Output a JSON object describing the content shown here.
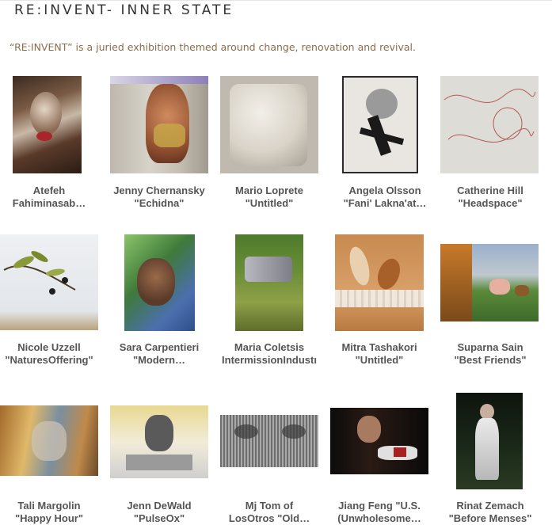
{
  "page": {
    "title": "RE:INVENT- INNER STATE",
    "subtitle": "“RE:INVENT” is a juried exhibition themed around change, renovation and revival."
  },
  "artworks": [
    {
      "line1": "Atefeh",
      "line2": "Fahiminasab…"
    },
    {
      "line1": "Jenny Chernansky",
      "line2": "\"Echidna\""
    },
    {
      "line1": "Mario Loprete",
      "line2": "\"Untitled\""
    },
    {
      "line1": "Angela Olsson",
      "line2": "\"Fani' Lakna'at…"
    },
    {
      "line1": "Catherine Hill",
      "line2": "\"Headspace\""
    },
    {
      "line1": "Nicole Uzzell",
      "line2": "\"NaturesOffering\""
    },
    {
      "line1": "Sara Carpentieri",
      "line2": "\"Modern…"
    },
    {
      "line1": "Maria Coletsis",
      "line2": "IntermissionIndustı"
    },
    {
      "line1": "Mitra Tashakori",
      "line2": "\"Untitled\""
    },
    {
      "line1": "Suparna Sain",
      "line2": "\"Best Friends\""
    },
    {
      "line1": "Tali Margolin",
      "line2": "\"Happy Hour\""
    },
    {
      "line1": "Jenn DeWald",
      "line2": "\"PulseOx\""
    },
    {
      "line1": "Mj Tom of",
      "line2": "LosOtros \"Old…"
    },
    {
      "line1": "Jiang Feng \"U.S.",
      "line2": "(Unwholesome…"
    },
    {
      "line1": "Rinat Zemach",
      "line2": "\"Before Menses\""
    }
  ]
}
